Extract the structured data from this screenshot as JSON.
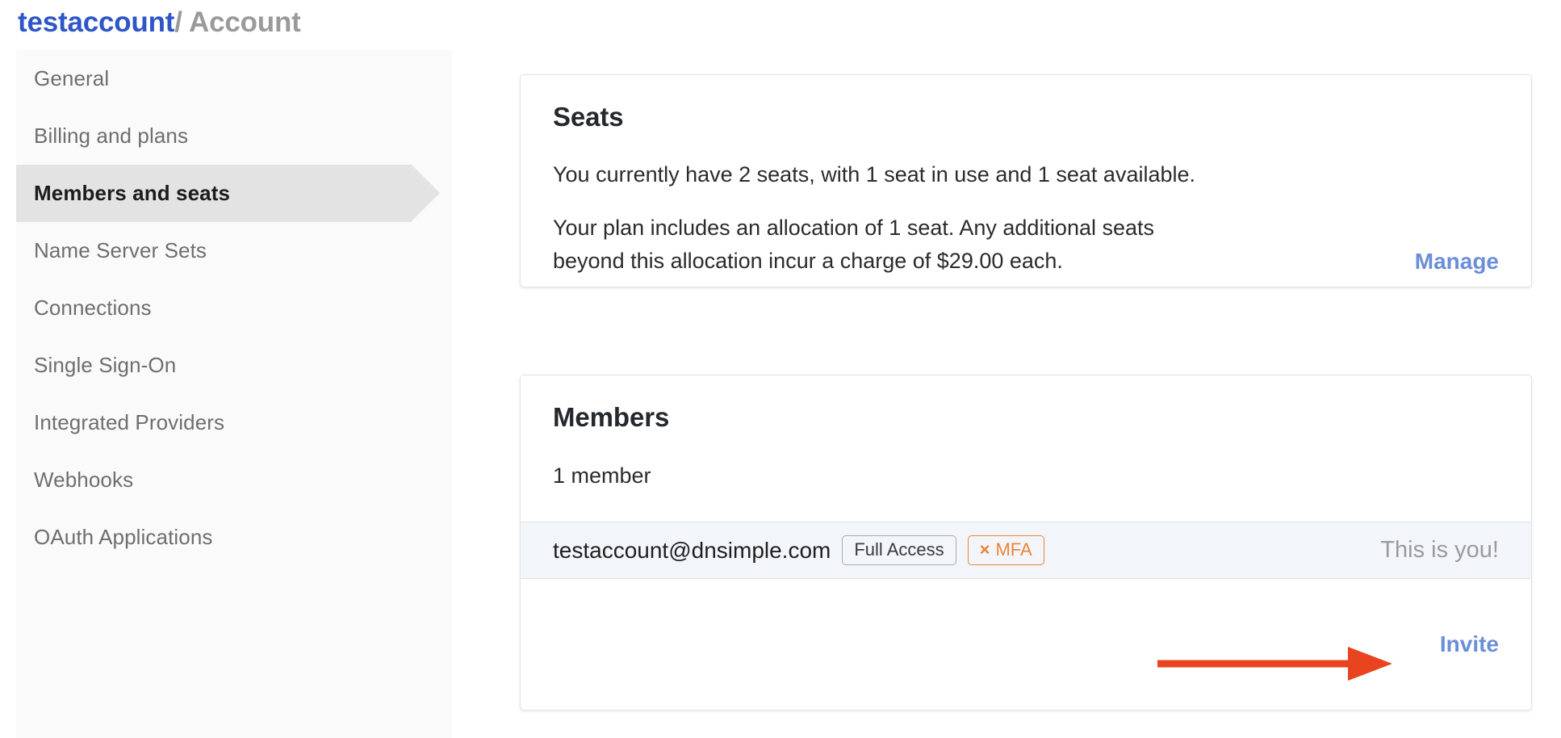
{
  "breadcrumb": {
    "account": "testaccount",
    "separator": "/",
    "page": "Account"
  },
  "sidebar": {
    "items": [
      {
        "label": "General",
        "active": false
      },
      {
        "label": "Billing and plans",
        "active": false
      },
      {
        "label": "Members and seats",
        "active": true
      },
      {
        "label": "Name Server Sets",
        "active": false
      },
      {
        "label": "Connections",
        "active": false
      },
      {
        "label": "Single Sign-On",
        "active": false
      },
      {
        "label": "Integrated Providers",
        "active": false
      },
      {
        "label": "Webhooks",
        "active": false
      },
      {
        "label": "OAuth Applications",
        "active": false
      }
    ]
  },
  "seats_card": {
    "title": "Seats",
    "summary": "You currently have 2 seats, with 1 seat in use and 1 seat available.",
    "allocation": "Your plan includes an allocation of 1 seat. Any additional seats beyond this allocation incur a charge of $29.00 each.",
    "manage_label": "Manage"
  },
  "members_card": {
    "title": "Members",
    "count_label": "1 member",
    "rows": [
      {
        "email": "testaccount@dnsimple.com",
        "role_badge": "Full Access",
        "mfa_mark": "×",
        "mfa_label": "MFA",
        "you_label": "This is you!"
      }
    ],
    "invite_label": "Invite"
  },
  "annotation": {
    "type": "arrow-right",
    "color": "#e8441f",
    "points_to": "Invite"
  },
  "colors": {
    "link_blue": "#6a8ed8",
    "breadcrumb_blue": "#2f56c8",
    "mfa_orange": "#ed8436",
    "row_highlight": "#f2f6fb",
    "sidebar_active": "#e3e3e3",
    "annotation_red": "#e8441f"
  }
}
